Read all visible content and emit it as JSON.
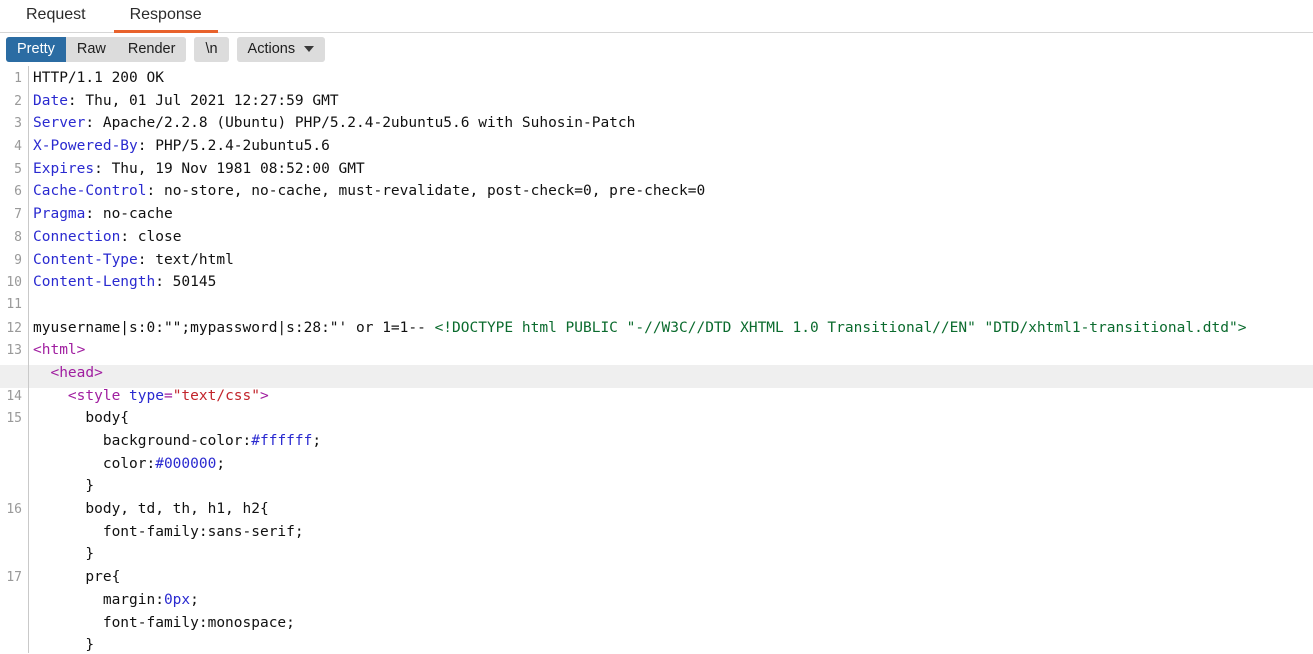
{
  "tabs": [
    {
      "label": "Request",
      "active": false
    },
    {
      "label": "Response",
      "active": true
    }
  ],
  "toolbar": {
    "pretty_label": "Pretty",
    "raw_label": "Raw",
    "render_label": "Render",
    "newline_label": "\\n",
    "actions_label": "Actions",
    "caret_icon": "chevron-down-icon",
    "selected": "Pretty"
  },
  "colors": {
    "accent_orange": "#e8622c",
    "selected_blue": "#2b6ca3",
    "button_gray": "#dcdcdc",
    "highlight_row": "#efefef",
    "header_name": "#2a2ad0",
    "doctype_green": "#0b6b2e",
    "tag_purple": "#a01ea0",
    "attr_blue": "#2a2ad0",
    "attr_value_red": "#c2242b"
  },
  "response": {
    "lines": [
      {
        "n": "1",
        "highlight": false,
        "parts": [
          {
            "t": "HTTP/1.1 200 OK",
            "c": "plain"
          }
        ]
      },
      {
        "n": "2",
        "highlight": false,
        "parts": [
          {
            "t": "Date",
            "c": "hdr-name"
          },
          {
            "t": ": Thu, 01 Jul 2021 12:27:59 GMT",
            "c": "plain"
          }
        ]
      },
      {
        "n": "3",
        "highlight": false,
        "parts": [
          {
            "t": "Server",
            "c": "hdr-name"
          },
          {
            "t": ": Apache/2.2.8 (Ubuntu) PHP/5.2.4-2ubuntu5.6 with Suhosin-Patch",
            "c": "plain"
          }
        ]
      },
      {
        "n": "4",
        "highlight": false,
        "parts": [
          {
            "t": "X-Powered-By",
            "c": "hdr-name"
          },
          {
            "t": ": PHP/5.2.4-2ubuntu5.6",
            "c": "plain"
          }
        ]
      },
      {
        "n": "5",
        "highlight": false,
        "parts": [
          {
            "t": "Expires",
            "c": "hdr-name"
          },
          {
            "t": ": Thu, 19 Nov 1981 08:52:00 GMT",
            "c": "plain"
          }
        ]
      },
      {
        "n": "6",
        "highlight": false,
        "parts": [
          {
            "t": "Cache-Control",
            "c": "hdr-name"
          },
          {
            "t": ": no-store, no-cache, must-revalidate, post-check=0, pre-check=0",
            "c": "plain"
          }
        ]
      },
      {
        "n": "7",
        "highlight": false,
        "parts": [
          {
            "t": "Pragma",
            "c": "hdr-name"
          },
          {
            "t": ": no-cache",
            "c": "plain"
          }
        ]
      },
      {
        "n": "8",
        "highlight": false,
        "parts": [
          {
            "t": "Connection",
            "c": "hdr-name"
          },
          {
            "t": ": close",
            "c": "plain"
          }
        ]
      },
      {
        "n": "9",
        "highlight": false,
        "parts": [
          {
            "t": "Content-Type",
            "c": "hdr-name"
          },
          {
            "t": ": text/html",
            "c": "plain"
          }
        ]
      },
      {
        "n": "10",
        "highlight": false,
        "parts": [
          {
            "t": "Content-Length",
            "c": "hdr-name"
          },
          {
            "t": ": 50145",
            "c": "plain"
          }
        ]
      },
      {
        "n": "11",
        "highlight": false,
        "parts": [
          {
            "t": "",
            "c": "plain"
          }
        ]
      },
      {
        "n": "12",
        "highlight": false,
        "parts": [
          {
            "t": "myusername|s:0:\"\";mypassword|s:28:\"' or 1=1-- ",
            "c": "plain"
          },
          {
            "t": "<!DOCTYPE html PUBLIC \"-//W3C//DTD XHTML 1.0 Transitional//EN\" \"DTD/xhtml1-transitional.dtd\">",
            "c": "doctype"
          }
        ]
      },
      {
        "n": "13",
        "highlight": false,
        "parts": [
          {
            "t": "<html>",
            "c": "tag"
          }
        ]
      },
      {
        "n": "",
        "highlight": true,
        "parts": [
          {
            "t": "  <head>",
            "c": "tag"
          }
        ]
      },
      {
        "n": "14",
        "highlight": false,
        "parts": [
          {
            "t": "    <style ",
            "c": "tag"
          },
          {
            "t": "type",
            "c": "attr"
          },
          {
            "t": "=",
            "c": "tag"
          },
          {
            "t": "\"text/css\"",
            "c": "attrval"
          },
          {
            "t": ">",
            "c": "tag"
          }
        ]
      },
      {
        "n": "15",
        "highlight": false,
        "parts": [
          {
            "t": "      body{",
            "c": "plain"
          }
        ]
      },
      {
        "n": "",
        "highlight": false,
        "parts": [
          {
            "t": "        background-color:",
            "c": "plain"
          },
          {
            "t": "#ffffff",
            "c": "cssval"
          },
          {
            "t": ";",
            "c": "plain"
          }
        ]
      },
      {
        "n": "",
        "highlight": false,
        "parts": [
          {
            "t": "        color:",
            "c": "plain"
          },
          {
            "t": "#000000",
            "c": "cssval"
          },
          {
            "t": ";",
            "c": "plain"
          }
        ]
      },
      {
        "n": "",
        "highlight": false,
        "parts": [
          {
            "t": "      }",
            "c": "plain"
          }
        ]
      },
      {
        "n": "16",
        "highlight": false,
        "parts": [
          {
            "t": "      body, td, th, h1, h2{",
            "c": "plain"
          }
        ]
      },
      {
        "n": "",
        "highlight": false,
        "parts": [
          {
            "t": "        font-family:sans-serif;",
            "c": "plain"
          }
        ]
      },
      {
        "n": "",
        "highlight": false,
        "parts": [
          {
            "t": "      }",
            "c": "plain"
          }
        ]
      },
      {
        "n": "17",
        "highlight": false,
        "parts": [
          {
            "t": "      pre{",
            "c": "plain"
          }
        ]
      },
      {
        "n": "",
        "highlight": false,
        "parts": [
          {
            "t": "        margin:",
            "c": "plain"
          },
          {
            "t": "0px",
            "c": "cssval"
          },
          {
            "t": ";",
            "c": "plain"
          }
        ]
      },
      {
        "n": "",
        "highlight": false,
        "parts": [
          {
            "t": "        font-family:monospace;",
            "c": "plain"
          }
        ]
      },
      {
        "n": "",
        "highlight": false,
        "parts": [
          {
            "t": "      }",
            "c": "plain"
          }
        ]
      }
    ]
  }
}
